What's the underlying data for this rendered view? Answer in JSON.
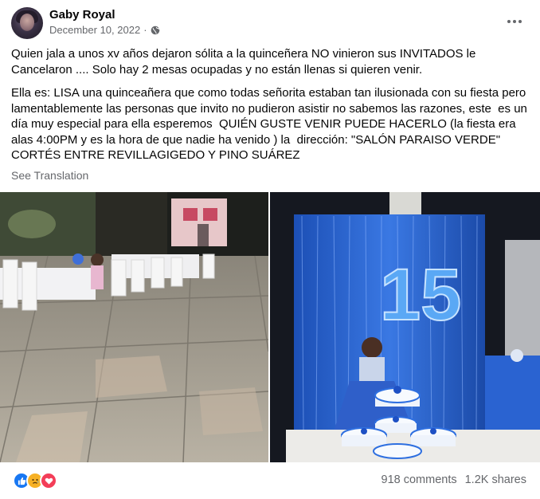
{
  "post": {
    "author": "Gaby Royal",
    "date": "December 10, 2022",
    "separator": "·",
    "privacy_icon": "globe-icon",
    "more_icon": "more-horizontal-icon",
    "paragraph_1": "Quien jala a unos xv años dejaron sólita a la quinceñera NO vinieron sus INVITADOS le Cancelaron .... Solo hay 2 mesas ocupadas y no están llenas si quieren venir.",
    "paragraph_2": "Ella es: LISA una quinceañera que como todas señorita estaban tan ilusionada con su fiesta pero lamentablemente las personas que invito no pudieron asistir no sabemos las razones, este  es un día muy especial para ella esperemos  QUIÉN GUSTE VENIR PUEDE HACERLO (la fiesta era  alas 4:00PM y es la hora de que nadie ha venido ) la  dirección: \"SALÓN PARAISO VERDE\" CORTÉS ENTRE REVILLAGIGEDO Y PINO SUÁREZ",
    "see_translation": "See Translation"
  },
  "photos": {
    "left_icon": "photo-empty-tables",
    "right_icon": "photo-quinceanera-cake",
    "balloon_number": "15"
  },
  "footer": {
    "reactions": [
      "like-icon",
      "sad-icon",
      "love-icon"
    ],
    "comments": "918 comments",
    "shares": "1.2K shares"
  },
  "colors": {
    "secondary_text": "#65676b",
    "like_blue": "#1877f2",
    "love_red": "#f33e58",
    "sad_yellow": "#f7b125"
  }
}
